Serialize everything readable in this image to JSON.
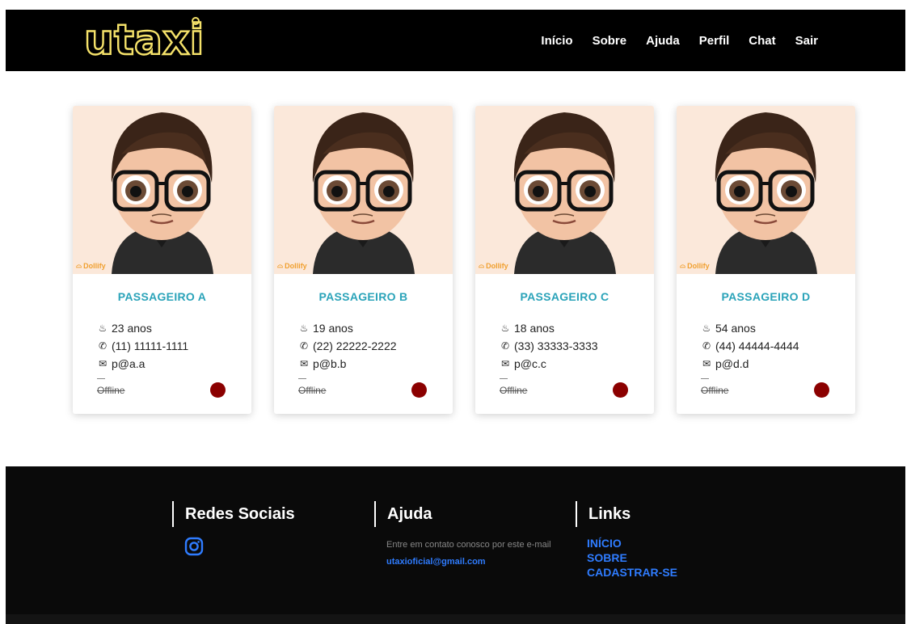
{
  "header": {
    "logo": "utaxi",
    "nav": [
      "Início",
      "Sobre",
      "Ajuda",
      "Perfil",
      "Chat",
      "Sair"
    ]
  },
  "cards": [
    {
      "name": "PASSAGEIRO A",
      "age": "23 anos",
      "phone": "(11) 11111-1111",
      "email": "p@a.a",
      "status": "Offline",
      "brand": "Dollify"
    },
    {
      "name": "PASSAGEIRO B",
      "age": "19 anos",
      "phone": "(22) 22222-2222",
      "email": "p@b.b",
      "status": "Offline",
      "brand": "Dollify"
    },
    {
      "name": "PASSAGEIRO C",
      "age": "18 anos",
      "phone": "(33) 33333-3333",
      "email": "p@c.c",
      "status": "Offline",
      "brand": "Dollify"
    },
    {
      "name": "PASSAGEIRO D",
      "age": "54 anos",
      "phone": "(44) 44444-4444",
      "email": "p@d.d",
      "status": "Offline",
      "brand": "Dollify"
    }
  ],
  "footer": {
    "social": {
      "title": "Redes Sociais",
      "icon": "instagram-icon"
    },
    "help": {
      "title": "Ajuda",
      "text": "Entre em contato conosco por este e-mail",
      "email": "utaxioficial@gmail.com"
    },
    "links": {
      "title": "Links",
      "items": [
        "INÍCIO",
        "SOBRE",
        "CADASTRAR-SE"
      ]
    }
  },
  "colors": {
    "accent": "#2aa3b9",
    "link": "#2f7cff",
    "status_offline": "#8b0000",
    "logo_glow": "#f5e26a"
  }
}
